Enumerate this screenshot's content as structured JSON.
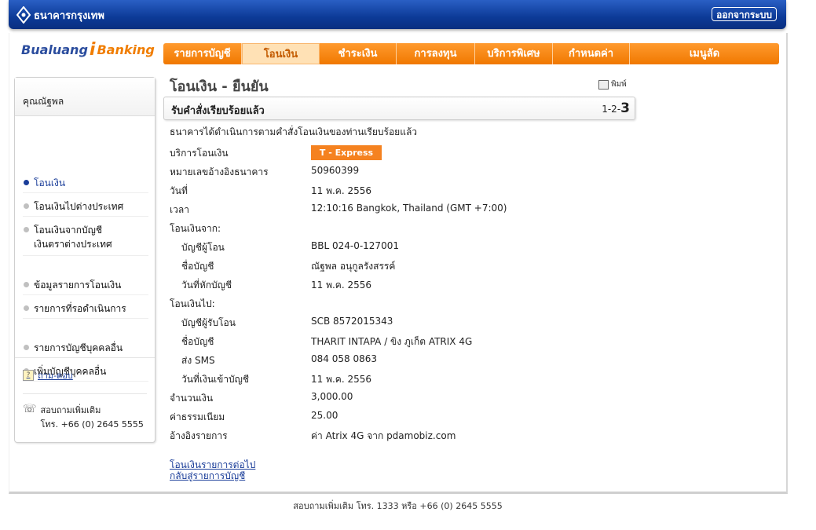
{
  "header": {
    "bank_name": "ธนาคารกรุงเทพ",
    "logout_label": "ออกจากระบบ"
  },
  "brand": {
    "part1": "Bualuang",
    "part2": "i",
    "part3": "Banking"
  },
  "nav": {
    "items": [
      "รายการบัญชี",
      "โอนเงิน",
      "ชำระเงิน",
      "การลงทุน",
      "บริการพิเศษ",
      "กำหนดค่า",
      "เมนูลัด"
    ],
    "active_index": 1
  },
  "sidebar": {
    "user_name": "คุณณัฐพล",
    "items": [
      "โอนเงิน",
      "โอนเงินไปต่างประเทศ",
      "โอนเงินจากบัญชี\nเงินตราต่างประเทศ",
      "ข้อมูลรายการโอนเงิน",
      "รายการที่รอดำเนินการ",
      "รายการบัญชีบุคคลอื่น",
      "เพิ่มบัญชีบุคคลอื่น"
    ],
    "faq_label": "ถาม-ตอบ",
    "contact_line1": "สอบถามเพิ่มเติม",
    "contact_line2": "โทร. +66 (0) 2645 5555"
  },
  "main": {
    "title": "โอนเงิน - ยืนยัน",
    "print_label": "พิมพ์",
    "status_text": "รับคำสั่งเรียบร้อยแล้ว",
    "steps_prefix": "1-2-",
    "steps_current": "3",
    "confirm_msg": "ธนาคารได้ดำเนินการตามคำสั่งโอนเงินของท่านเรียบร้อยแล้ว",
    "service_label": "บริการโอนเงิน",
    "service_badge": "T - Express",
    "rows": [
      {
        "label": "หมายเลขอ้างอิงธนาคาร",
        "value": "50960399"
      },
      {
        "label": "วันที่",
        "value": "11 พ.ค. 2556"
      },
      {
        "label": "เวลา",
        "value": "12:10:16 Bangkok, Thailand (GMT +7:00)"
      },
      {
        "label": "โอนเงินจาก:",
        "value": ""
      },
      {
        "label": "บัญชีผู้โอน",
        "value": "BBL 024-0-127001",
        "sub": true
      },
      {
        "label": "ชื่อบัญชี",
        "value": "ณัฐพล อนุกูลรังสรรค์",
        "sub": true
      },
      {
        "label": "วันที่หักบัญชี",
        "value": "11 พ.ค. 2556",
        "sub": true
      },
      {
        "label": "โอนเงินไป:",
        "value": ""
      },
      {
        "label": "บัญชีผู้รับโอน",
        "value": "SCB 8572015343",
        "sub": true
      },
      {
        "label": "ชื่อบัญชี",
        "value": "THARIT INTAPA / ขิง ภูเก็ต ATRIX 4G",
        "sub": true
      },
      {
        "label": "ส่ง SMS",
        "value": "084 058 0863",
        "sub": true
      },
      {
        "label": "วันที่เงินเข้าบัญชี",
        "value": "11 พ.ค. 2556",
        "sub": true
      },
      {
        "label": "จำนวนเงิน",
        "value": "3,000.00"
      },
      {
        "label": "ค่าธรรมเนียม",
        "value": "25.00"
      },
      {
        "label": "อ้างอิงรายการ",
        "value": "ค่า Atrix 4G จาก pdamobiz.com"
      }
    ],
    "link_next": "โอนเงินรายการต่อไป",
    "link_back": "กลับสู่รายการบัญชี"
  },
  "footer": {
    "text": "สอบถามเพิ่มเติม โทร. 1333 หรือ +66 (0) 2645 5555"
  },
  "colors": {
    "nav_orange": "#f07800",
    "header_blue": "#0c3a97",
    "link_blue": "#1a3d99"
  }
}
